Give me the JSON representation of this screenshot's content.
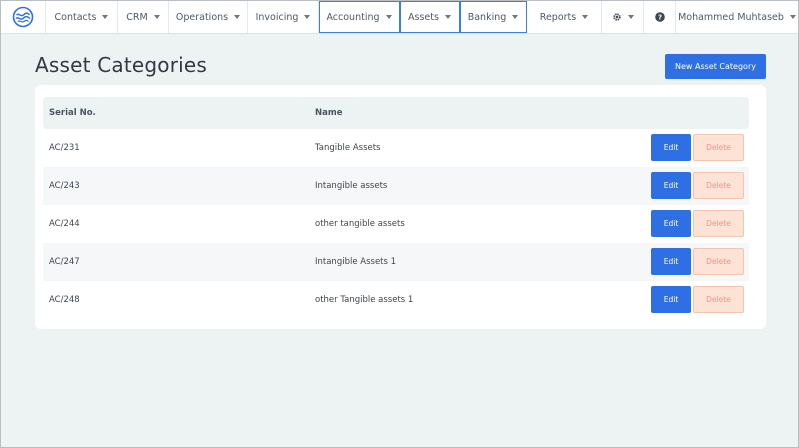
{
  "nav": {
    "items": [
      {
        "label": "Contacts",
        "dropdown": true,
        "active": false
      },
      {
        "label": "CRM",
        "dropdown": true,
        "active": false
      },
      {
        "label": "Operations",
        "dropdown": true,
        "active": false
      },
      {
        "label": "Invoicing",
        "dropdown": true,
        "active": false
      },
      {
        "label": "Accounting",
        "dropdown": true,
        "active": true
      },
      {
        "label": "Assets",
        "dropdown": true,
        "active": true
      },
      {
        "label": "Banking",
        "dropdown": true,
        "active": true
      },
      {
        "label": "Reports",
        "dropdown": true,
        "active": false
      }
    ],
    "settings_icon": "gear-icon",
    "help_icon": "question-circle-icon",
    "user_name": "Mohammed Muhtaseb"
  },
  "page": {
    "title": "Asset Categories",
    "new_button_label": "New Asset Category"
  },
  "table": {
    "columns": {
      "serial": "Serial No.",
      "name": "Name"
    },
    "edit_label": "Edit",
    "delete_label": "Delete",
    "rows": [
      {
        "serial": "AC/231",
        "name": "Tangible Assets"
      },
      {
        "serial": "AC/243",
        "name": "Intangible assets"
      },
      {
        "serial": "AC/244",
        "name": "other tangible assets"
      },
      {
        "serial": "AC/247",
        "name": "Intangible Assets 1"
      },
      {
        "serial": "AC/248",
        "name": "other Tangible assets 1"
      }
    ]
  },
  "colors": {
    "primary": "#2f6fe4",
    "danger_bg": "#fde2d6",
    "danger_text": "#f2977a",
    "active_nav_outline": "#3b82d6",
    "page_bg": "#edf2f3"
  }
}
